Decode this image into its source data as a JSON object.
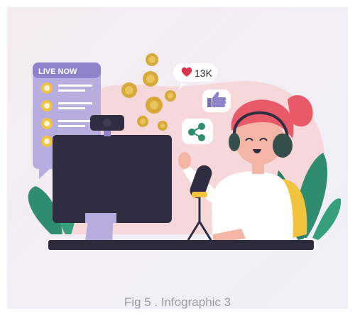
{
  "caption": "Fig 5 . Infographic 3",
  "illustration": {
    "live_badge": "LIVE NOW",
    "like_count": "13K",
    "palette": {
      "panel": "#b7aedf",
      "panel_dark": "#8f84cc",
      "monitor": "#2f2d3f",
      "hair": "#e85a68",
      "coin": "#d6aa3a",
      "leaf": "#2f8c6e",
      "chair": "#f1c33f",
      "desk": "#2c2a3b",
      "bg_blob": "#f6d5d7"
    },
    "icons": [
      "live-panel-icon",
      "coin-icon",
      "heart-icon",
      "thumbs-up-icon",
      "share-icon",
      "webcam-icon",
      "microphone-icon",
      "headphones-icon"
    ]
  }
}
